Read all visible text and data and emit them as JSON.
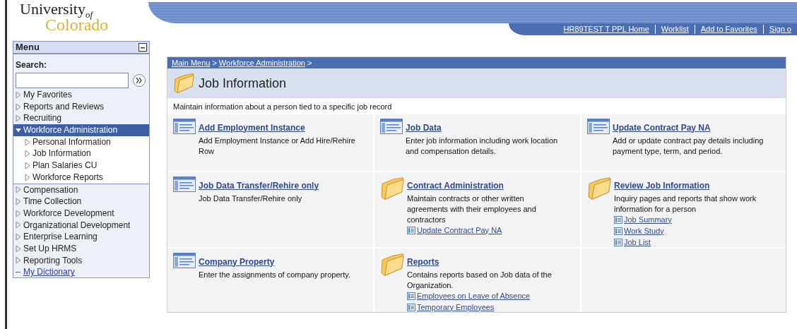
{
  "logo": {
    "line1": "University",
    "of": "of",
    "line2": "Colorado"
  },
  "header_links": [
    "HR89TEST T PPL Home",
    "Worklist",
    "Add to Favorites",
    "Sign o"
  ],
  "menu": {
    "title": "Menu",
    "search_label": "Search:",
    "items": [
      {
        "label": "My Favorites",
        "kind": "folder",
        "expanded": false,
        "selected": false
      },
      {
        "label": "Reports and Reviews",
        "kind": "folder",
        "expanded": false,
        "selected": false
      },
      {
        "label": "Recruiting",
        "kind": "folder",
        "expanded": false,
        "selected": false
      },
      {
        "label": "Workforce Administration",
        "kind": "folder",
        "expanded": true,
        "selected": true,
        "children": [
          {
            "label": "Personal Information",
            "kind": "folder",
            "expanded": false,
            "selected": false
          },
          {
            "label": "Job Information",
            "kind": "folder",
            "expanded": false,
            "selected": false
          },
          {
            "label": "Plan Salaries CU",
            "kind": "folder",
            "expanded": false,
            "selected": false
          },
          {
            "label": "Workforce Reports",
            "kind": "folder",
            "expanded": false,
            "selected": false
          }
        ]
      },
      {
        "label": "Compensation",
        "kind": "folder",
        "expanded": false,
        "selected": false
      },
      {
        "label": "Time Collection",
        "kind": "folder",
        "expanded": false,
        "selected": false
      },
      {
        "label": "Workforce Development",
        "kind": "folder",
        "expanded": false,
        "selected": false
      },
      {
        "label": "Organizational Development",
        "kind": "folder",
        "expanded": false,
        "selected": false
      },
      {
        "label": "Enterprise Learning",
        "kind": "folder",
        "expanded": false,
        "selected": false
      },
      {
        "label": "Set Up HRMS",
        "kind": "folder",
        "expanded": false,
        "selected": false
      },
      {
        "label": "Reporting Tools",
        "kind": "folder",
        "expanded": false,
        "selected": false
      },
      {
        "label": "My Dictionary",
        "kind": "link",
        "selected": false
      }
    ]
  },
  "breadcrumb": [
    {
      "label": "Main Menu",
      "separator": ">"
    },
    {
      "label": "Workforce Administration",
      "separator": ">"
    }
  ],
  "page_title": "Job Information",
  "description": "Maintain information about a person tied to a specific job record",
  "tiles": [
    {
      "kind": "page",
      "title": "Add Employment Instance",
      "text": "Add Employment Instance or Add Hire/Rehire Row"
    },
    {
      "kind": "page",
      "title": "Job Data",
      "text": "Enter job information including work location and compensation details."
    },
    {
      "kind": "page",
      "title": "Update Contract Pay NA",
      "text": "Add or update contract pay details including payment type, term, and period."
    },
    {
      "kind": "page",
      "title": "Job Data Transfer/Rehire only",
      "text": "Job Data Transfer/Rehire only"
    },
    {
      "kind": "folder",
      "title": "Contract Administration",
      "text": "Maintain contracts or other written agreements with their employees and contractors",
      "links": [
        "Update Contract Pay NA"
      ]
    },
    {
      "kind": "folder",
      "title": "Review Job Information",
      "text": "Inquiry pages and reports that show work information for a person",
      "links": [
        "Job Summary",
        "Work Study",
        "Job List"
      ]
    },
    {
      "kind": "page",
      "title": "Company Property",
      "text": "Enter the assignments of company property."
    },
    {
      "kind": "folder",
      "title": "Reports",
      "text": "Contains reports based on Job data of the Organization.",
      "links": [
        "Employees on Leave of Absence",
        "Temporary Employees"
      ]
    }
  ]
}
